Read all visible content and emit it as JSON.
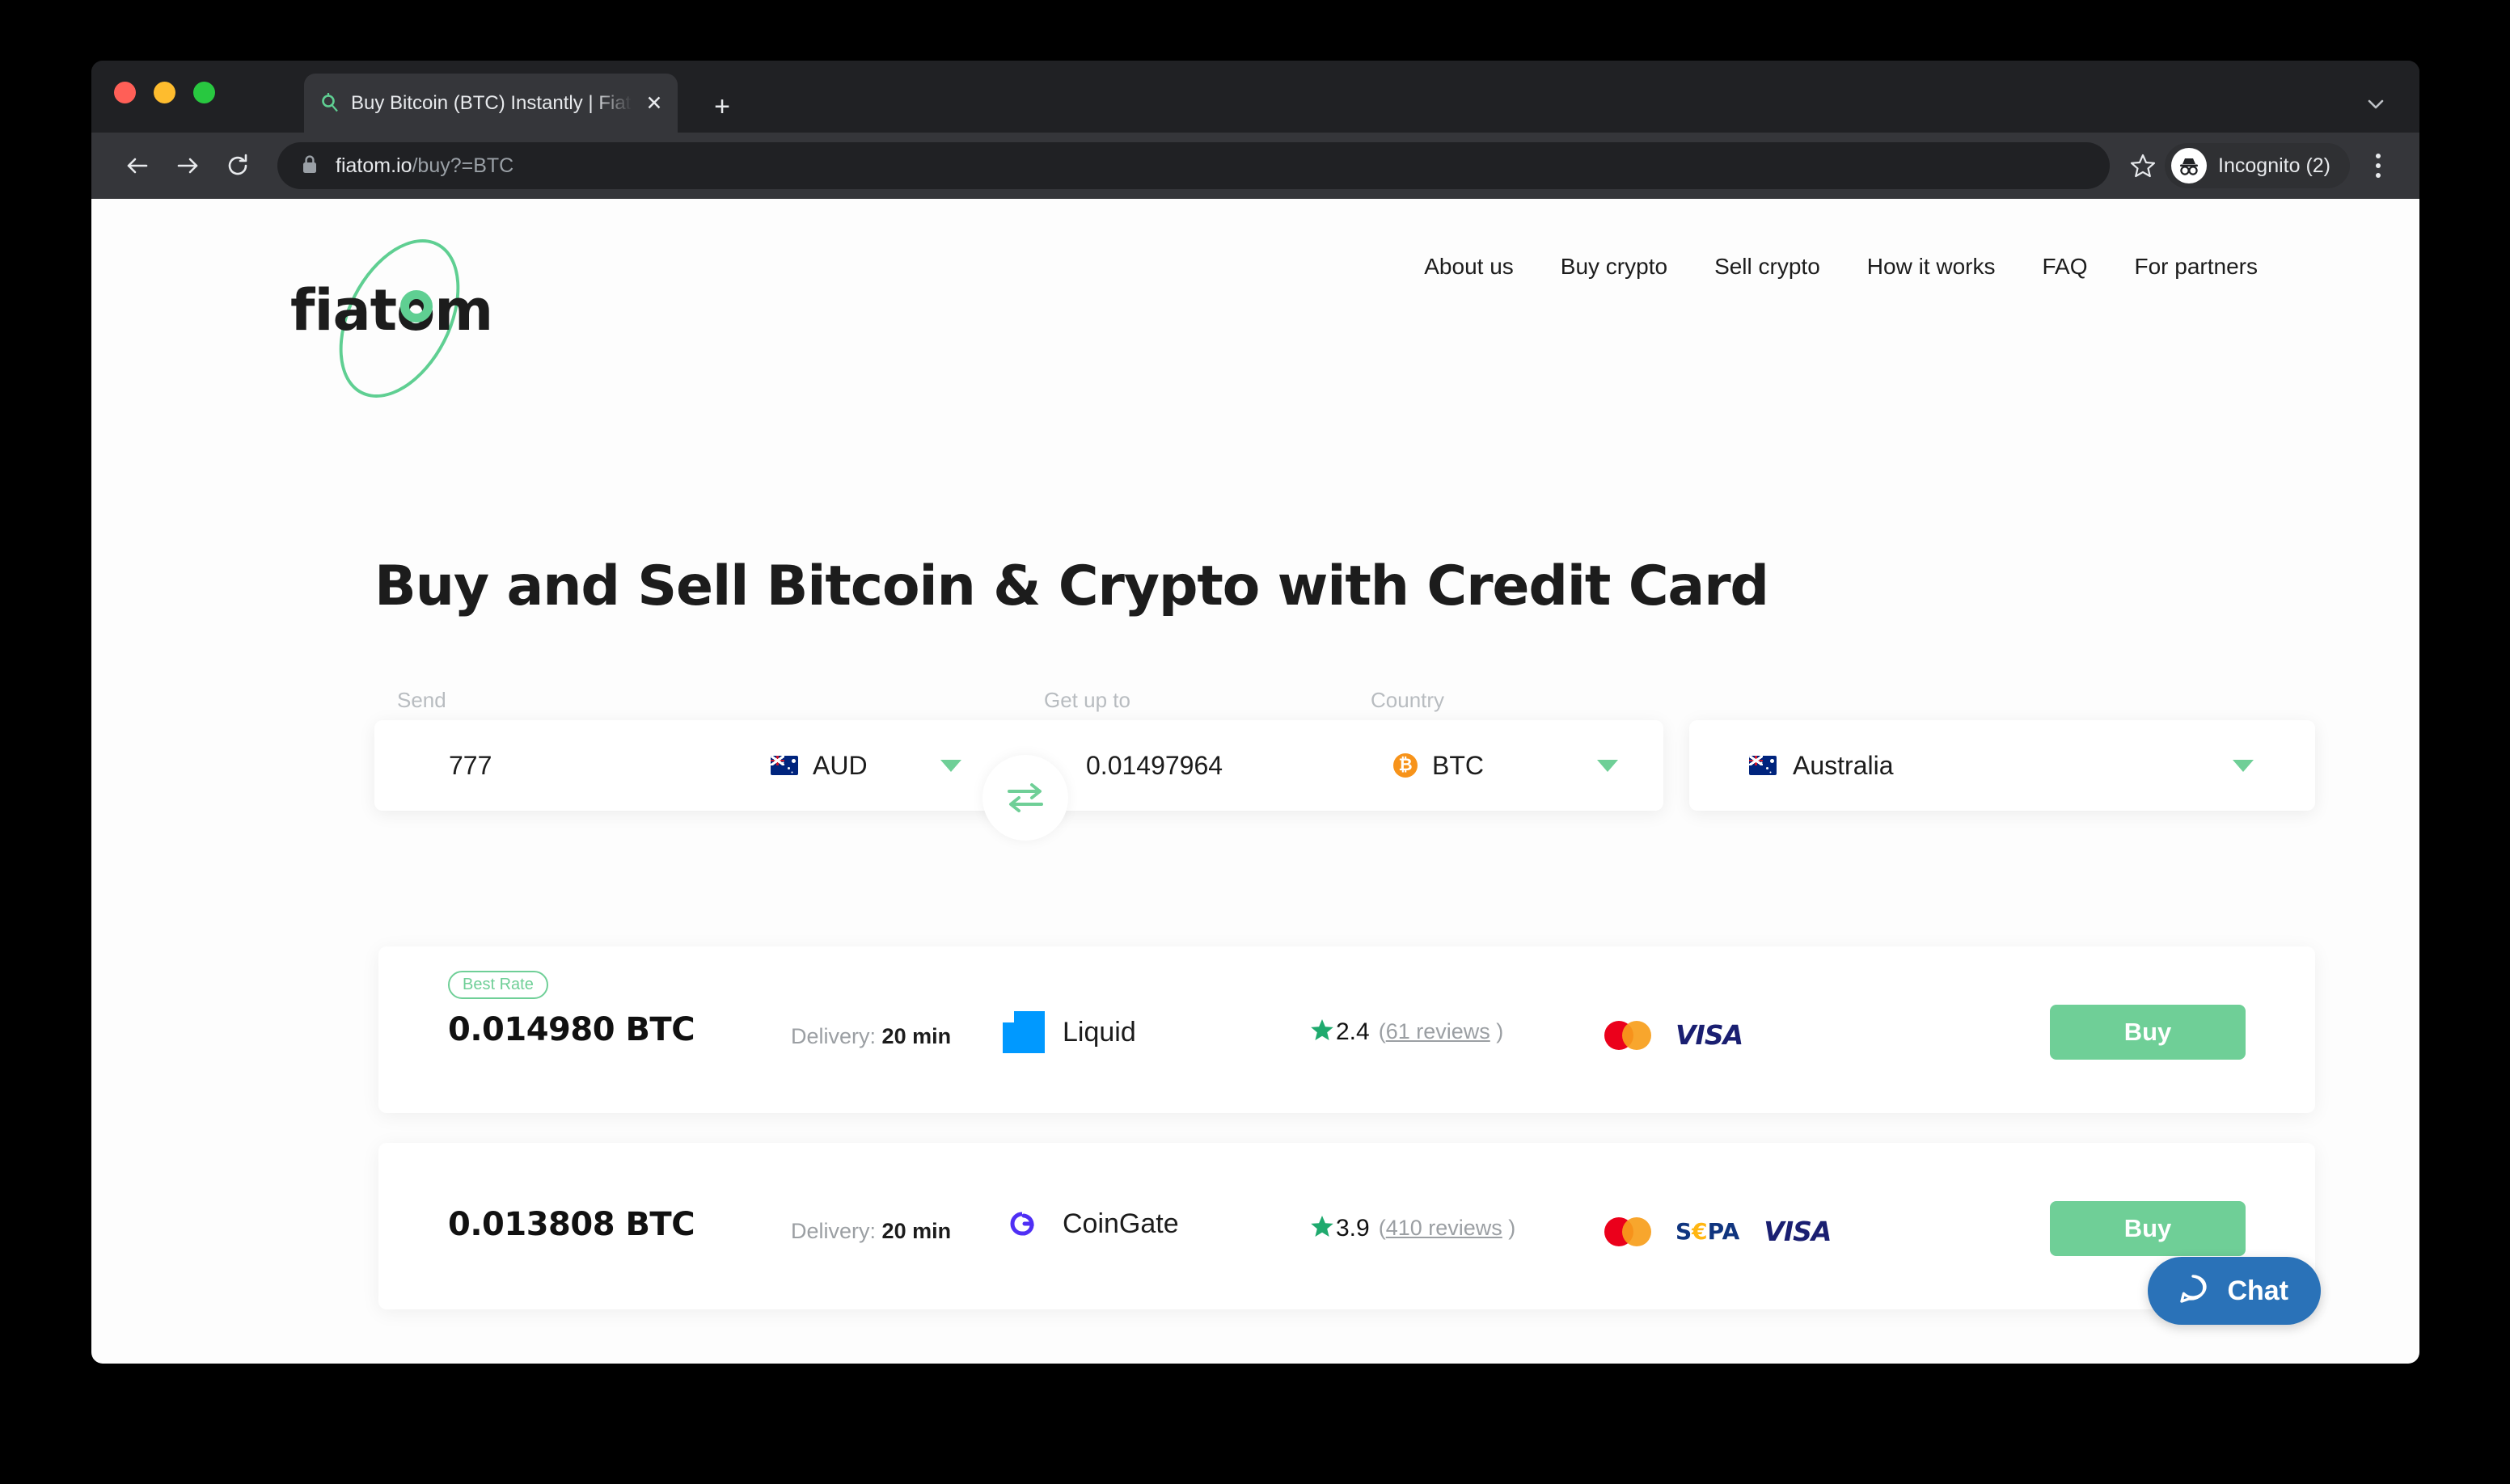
{
  "browser": {
    "tab_title": "Buy Bitcoin (BTC) Instantly | Fiatom",
    "tab_favicon_name": "fiatom-favicon",
    "close_tab_label": "✕",
    "new_tab_label": "+",
    "url_host": "fiatom.io",
    "url_path": "/buy?=BTC",
    "profile_label": "Incognito (2)",
    "back_label": "←",
    "forward_label": "→",
    "reload_label": "⟳"
  },
  "site": {
    "logo_text": "fiatom",
    "nav": [
      {
        "label": "About us"
      },
      {
        "label": "Buy crypto"
      },
      {
        "label": "Sell crypto"
      },
      {
        "label": "How it works"
      },
      {
        "label": "FAQ"
      },
      {
        "label": "For partners"
      }
    ],
    "page_title": "Buy and Sell Bitcoin & Crypto with Credit Card"
  },
  "exchange": {
    "send_label": "Send",
    "get_label": "Get up to",
    "country_label": "Country",
    "send_amount": "777",
    "send_currency": "AUD",
    "send_flag": "au-flag-icon",
    "get_amount": "0.01497964",
    "get_currency": "BTC",
    "get_currency_symbol": "₿",
    "country_value": "Australia",
    "country_flag": "au-flag-icon",
    "swap_icon": "swap-arrows-icon"
  },
  "offers": [
    {
      "badge": "Best Rate",
      "amount": "0.014980 BTC",
      "delivery_label": "Delivery:",
      "delivery_value": "20 min",
      "provider": "Liquid",
      "provider_logo": "liquid-logo-icon",
      "rating": "2.4",
      "reviews": "61 reviews",
      "payments": [
        "mastercard",
        "visa"
      ],
      "buy_label": "Buy"
    },
    {
      "badge": "",
      "amount": "0.013808 BTC",
      "delivery_label": "Delivery:",
      "delivery_value": "20 min",
      "provider": "CoinGate",
      "provider_logo": "coingate-logo-icon",
      "rating": "3.9",
      "reviews": "410 reviews",
      "payments": [
        "mastercard",
        "sepa",
        "visa"
      ],
      "buy_label": "Buy"
    }
  ],
  "chat": {
    "label": "Chat",
    "icon": "speech-bubble-icon"
  },
  "colors": {
    "accent_green": "#6fcf97",
    "bitcoin_orange": "#f7931a",
    "chat_blue": "#2a72b8",
    "liquid_blue": "#0099ff",
    "coingate_purple": "#4f2ff5"
  }
}
